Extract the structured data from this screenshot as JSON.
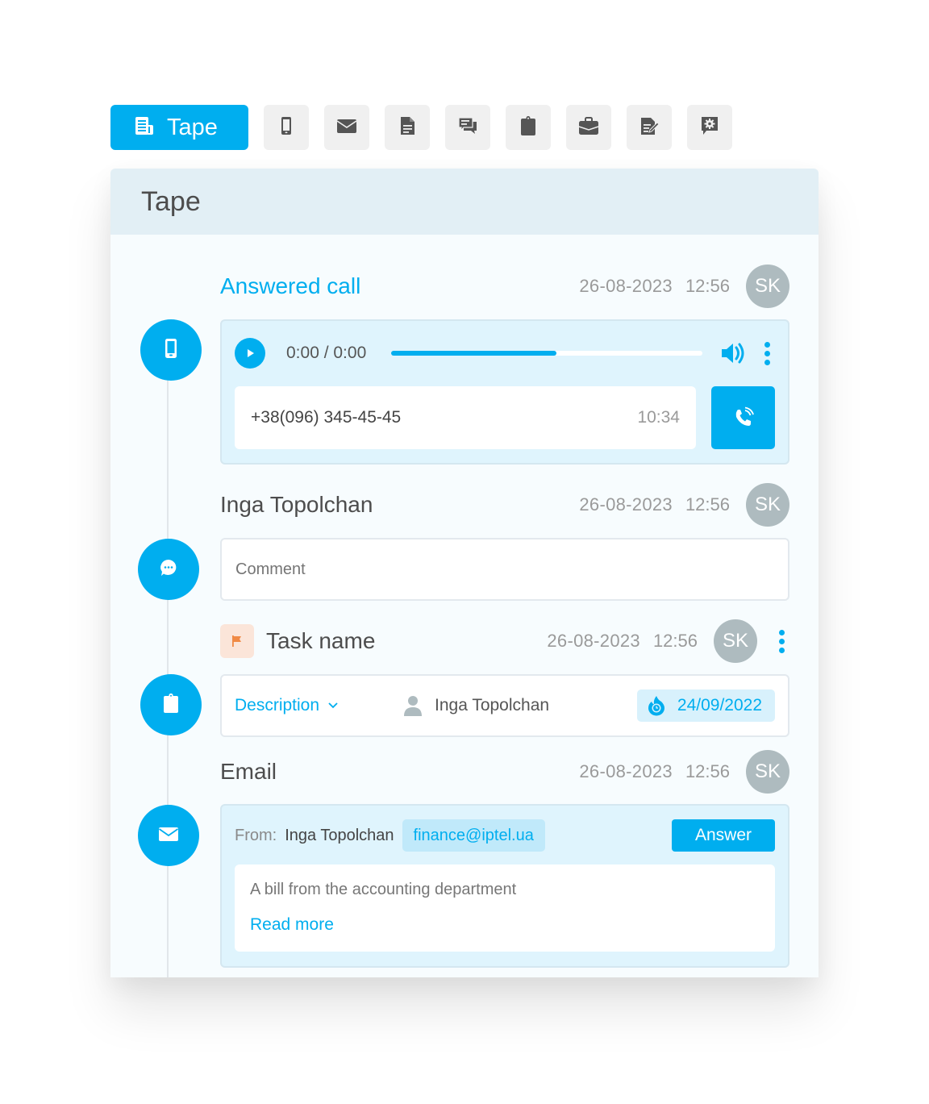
{
  "toolbar": {
    "active_label": "Tape",
    "tabs": [
      {
        "name": "tape",
        "icon": "newspaper-icon",
        "label": "Tape",
        "active": true
      },
      {
        "name": "calls",
        "icon": "mobile-phone-icon"
      },
      {
        "name": "email",
        "icon": "envelope-icon"
      },
      {
        "name": "documents",
        "icon": "document-icon"
      },
      {
        "name": "chats",
        "icon": "chat-bubbles-icon"
      },
      {
        "name": "tasks",
        "icon": "clipboard-icon"
      },
      {
        "name": "deals",
        "icon": "briefcase-icon"
      },
      {
        "name": "notes",
        "icon": "edit-document-icon"
      },
      {
        "name": "settings",
        "icon": "chat-settings-icon"
      }
    ]
  },
  "panel": {
    "title": "Tape"
  },
  "events": {
    "call": {
      "title": "Answered call",
      "date": "26-08-2023",
      "time": "12:56",
      "avatar": "SK",
      "player_time": "0:00 / 0:00",
      "progress": 0.53,
      "phone": "+38(096) 345-45-45",
      "duration": "10:34"
    },
    "comment": {
      "title": "Inga Topolchan",
      "date": "26-08-2023",
      "time": "12:56",
      "avatar": "SK",
      "placeholder": "Comment"
    },
    "task": {
      "title": "Task name",
      "date": "26-08-2023",
      "time": "12:56",
      "avatar": "SK",
      "description_label": "Description",
      "assignee": "Inga Topolchan",
      "due_date": "24/09/2022"
    },
    "email": {
      "title": "Email",
      "date": "26-08-2023",
      "time": "12:56",
      "avatar": "SK",
      "from_label": "From:",
      "from_name": "Inga Topolchan",
      "from_email": "finance@iptel.ua",
      "answer_label": "Answer",
      "body": "A bill from the accounting department",
      "read_more": "Read more"
    }
  },
  "colors": {
    "accent": "#00aeef",
    "header_bg": "#e2eff5",
    "avatar_bg": "#aebbbf",
    "flag": "#f08a45"
  }
}
